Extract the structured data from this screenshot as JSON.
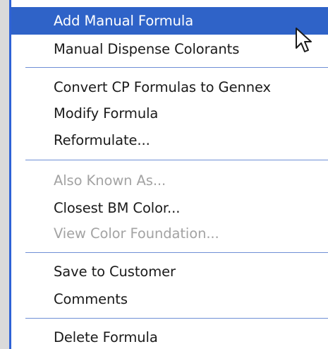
{
  "context_menu": {
    "items": [
      {
        "label": "Add Manual Formula",
        "enabled": true,
        "highlighted": true
      },
      {
        "label": "Manual Dispense Colorants",
        "enabled": true
      },
      {
        "label": "Convert CP Formulas to Gennex",
        "enabled": true
      },
      {
        "label": "Modify Formula",
        "enabled": true
      },
      {
        "label": "Reformulate...",
        "enabled": true
      },
      {
        "label": "Also Known As...",
        "enabled": false
      },
      {
        "label": "Closest BM Color...",
        "enabled": true
      },
      {
        "label": "View Color Foundation...",
        "enabled": false
      },
      {
        "label": "Save to Customer",
        "enabled": true
      },
      {
        "label": "Comments",
        "enabled": true
      },
      {
        "label": "Delete Formula",
        "enabled": true
      }
    ]
  },
  "colors": {
    "highlight": "#2f63c8",
    "separator": "#6f8fd6",
    "disabled_text": "#a3a3a3",
    "accent_border": "#2f63d6"
  },
  "cursor": "arrow-cursor-icon"
}
